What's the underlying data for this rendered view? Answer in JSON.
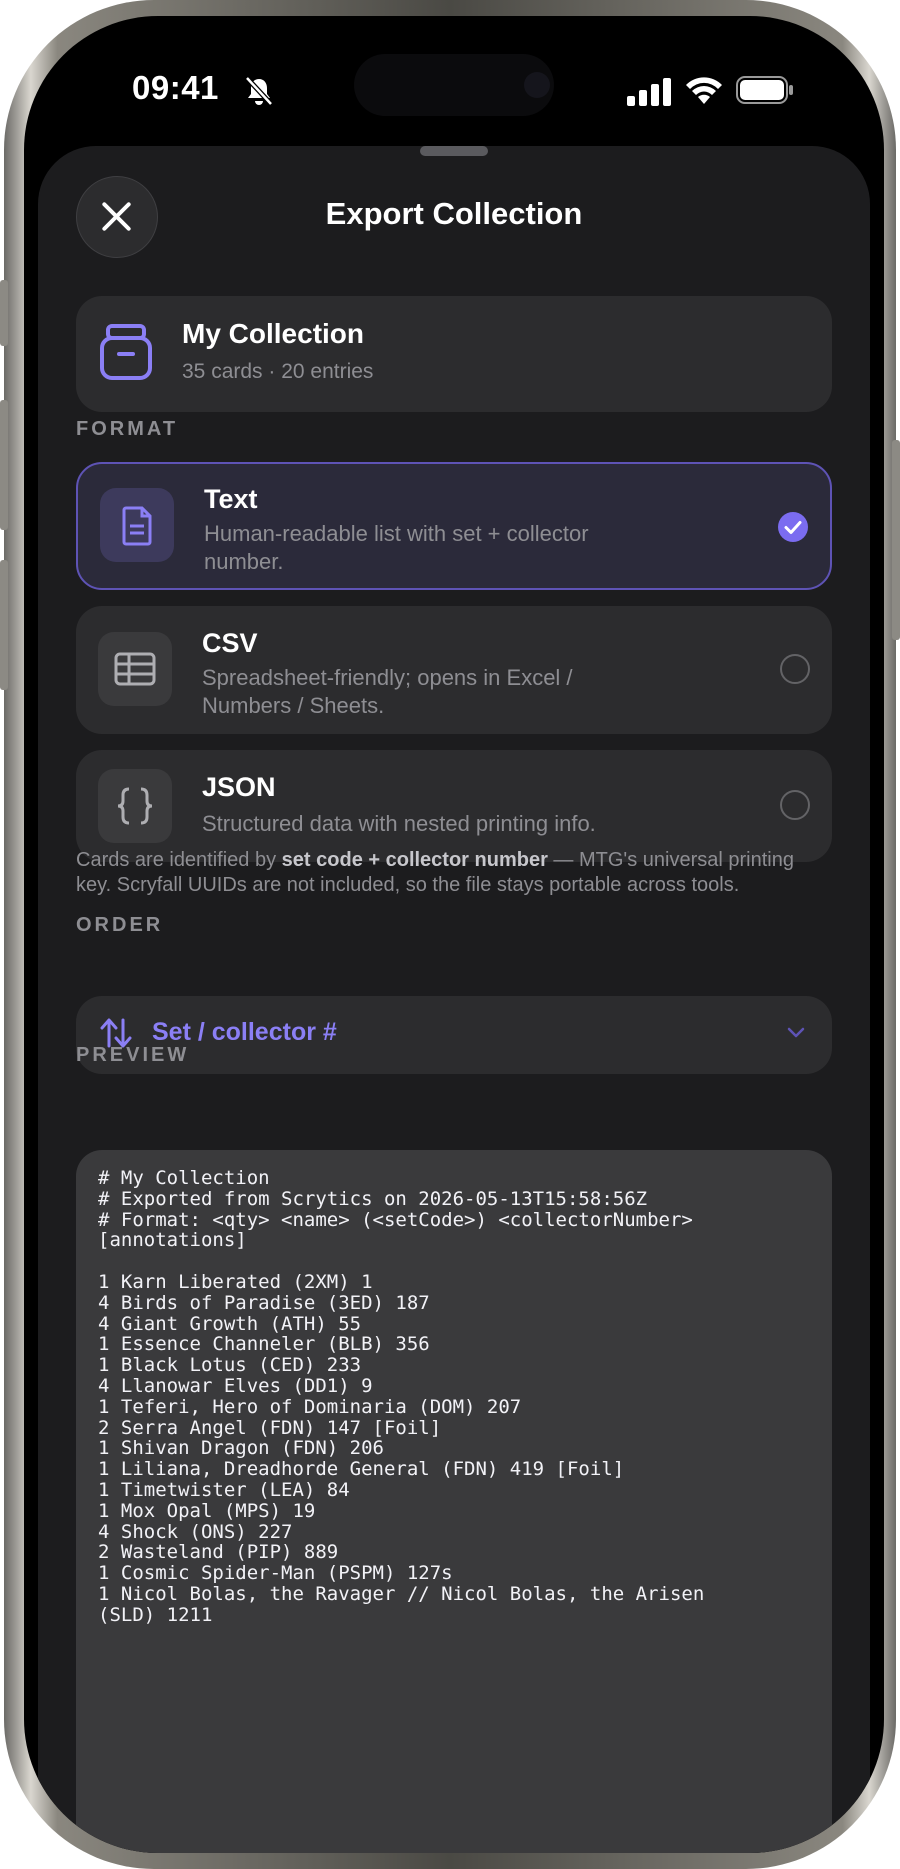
{
  "status": {
    "time": "09:41"
  },
  "sheet": {
    "title": "Export Collection"
  },
  "collection": {
    "name": "My Collection",
    "summary": "35 cards · 20 entries"
  },
  "format": {
    "label": "FORMAT",
    "options": [
      {
        "title": "Text",
        "description": "Human-readable list with set + collector number.",
        "selected": true,
        "icon": "document-icon"
      },
      {
        "title": "CSV",
        "description": "Spreadsheet-friendly; opens in Excel / Numbers / Sheets.",
        "selected": false,
        "icon": "table-icon"
      },
      {
        "title": "JSON",
        "description": "Structured data with nested printing info.",
        "selected": false,
        "icon": "braces-icon"
      }
    ]
  },
  "note": {
    "prefix": "Cards are identified by ",
    "bold": "set code + collector number",
    "suffix": " — MTG's universal printing key. Scryfall UUIDs are not included, so the file stays portable across tools."
  },
  "order": {
    "label": "ORDER",
    "value": "Set / collector #"
  },
  "preview": {
    "label": "PREVIEW",
    "lines": [
      "# My Collection",
      "# Exported from Scrytics on 2026-05-13T15:58:56Z",
      "# Format: <qty> <name> (<setCode>) <collectorNumber>",
      "[annotations]",
      "",
      "1 Karn Liberated (2XM) 1",
      "4 Birds of Paradise (3ED) 187",
      "4 Giant Growth (ATH) 55",
      "1 Essence Channeler (BLB) 356",
      "1 Black Lotus (CED) 233",
      "4 Llanowar Elves (DD1) 9",
      "1 Teferi, Hero of Dominaria (DOM) 207",
      "2 Serra Angel (FDN) 147 [Foil]",
      "1 Shivan Dragon (FDN) 206",
      "1 Liliana, Dreadhorde General (FDN) 419 [Foil]",
      "1 Timetwister (LEA) 84",
      "1 Mox Opal (MPS) 19",
      "4 Shock (ONS) 227",
      "2 Wasteland (PIP) 889",
      "1 Cosmic Spider-Man (PSPM) 127s",
      "1 Nicol Bolas, the Ravager // Nicol Bolas, the Arisen",
      "(SLD) 1211"
    ]
  },
  "colors": {
    "accent": "#7b6cf0",
    "background": "#1c1c1e",
    "card": "#2c2c2e"
  }
}
